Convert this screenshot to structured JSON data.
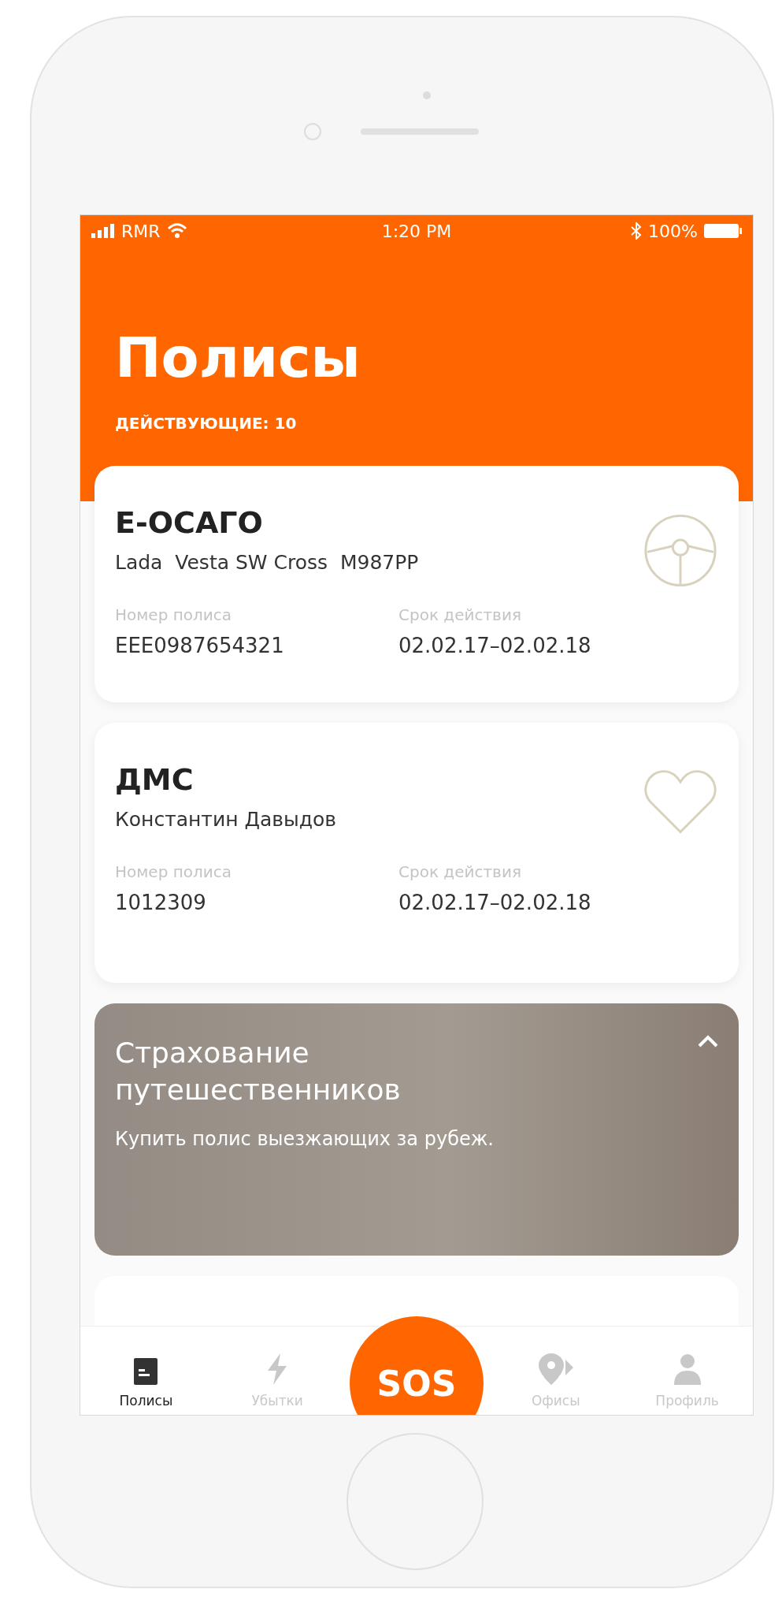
{
  "status_bar": {
    "carrier": "RMR",
    "time": "1:20 PM",
    "battery": "100%"
  },
  "header": {
    "title": "Полисы",
    "subtitle": "ДЕЙСТВУЮЩИЕ: 10"
  },
  "policies": [
    {
      "kind": "car",
      "title": "Е-ОСАГО",
      "subject": "Lada  Vesta SW Cross  М987РР",
      "fields": [
        {
          "label": "Номер полиса",
          "value": "EEE0987654321"
        },
        {
          "label": "Срок действия",
          "value": "02.02.17–02.02.18"
        }
      ]
    },
    {
      "kind": "health",
      "title": "ДМС",
      "subject": "Константин Давыдов",
      "fields": [
        {
          "label": "Номер полиса",
          "value": "1012309"
        },
        {
          "label": "Срок действия",
          "value": "02.02.17–02.02.18"
        }
      ]
    }
  ],
  "promo": {
    "title": "Страхование путешественников",
    "text": "Купить полис выезжающих за рубеж."
  },
  "tabs": [
    {
      "kind": "document",
      "label": "Полисы",
      "selected": true
    },
    {
      "kind": "bolt",
      "label": "Убытки",
      "selected": false
    },
    {
      "kind": "sos",
      "label": "SOS",
      "selected": false
    },
    {
      "kind": "pin",
      "label": "Офисы",
      "selected": false
    },
    {
      "kind": "person",
      "label": "Профиль",
      "selected": false
    }
  ]
}
